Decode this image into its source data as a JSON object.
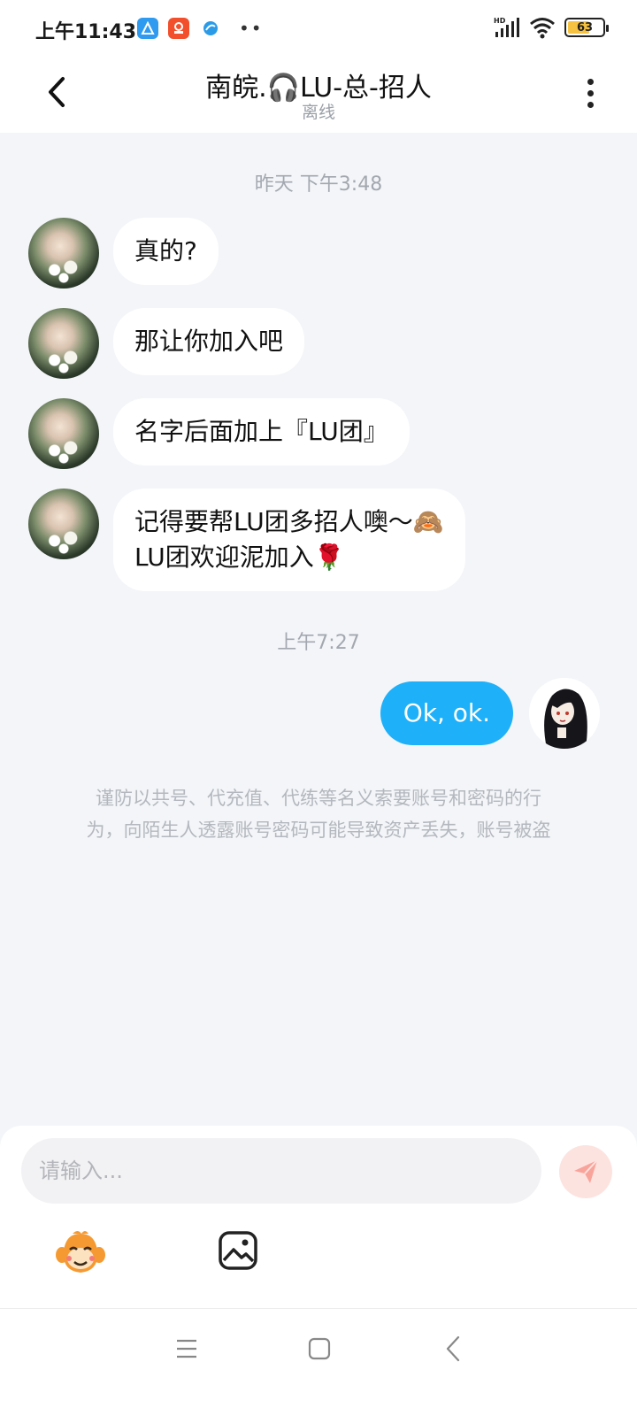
{
  "status_bar": {
    "time": "上午11:43",
    "battery": "63",
    "battery_level": 0.63,
    "icons": [
      "blue-a-app-icon",
      "orange-app-icon",
      "blue-bird-app-icon",
      "more-dots-icon",
      "hd-signal-icon",
      "wifi-icon",
      "battery-icon"
    ]
  },
  "header": {
    "title": "南皖.🎧LU-总-招人",
    "subtitle": "离线"
  },
  "messages": [
    {
      "type": "timestamp",
      "text": "昨天 下午3:48"
    },
    {
      "type": "incoming",
      "text": "真的?"
    },
    {
      "type": "incoming",
      "text": "那让你加入吧"
    },
    {
      "type": "incoming",
      "text": "名字后面加上『LU团』"
    },
    {
      "type": "incoming",
      "lines": [
        "记得要帮LU团多招人噢～🙈",
        "LU团欢迎泥加入🌹"
      ]
    },
    {
      "type": "timestamp",
      "text": "上午7:27"
    },
    {
      "type": "outgoing",
      "text": "Ok, ok."
    }
  ],
  "warning": {
    "lines": [
      "谨防以共号、代充值、代练等名义索要账号和密码的行",
      "为，向陌生人透露账号密码可能导致资产丢失，账号被盗"
    ]
  },
  "input": {
    "placeholder": "请输入..."
  },
  "colors": {
    "accent_blue": "#1eb0f8",
    "send_button_bg": "#fde3e0",
    "send_icon": "#f8a49a",
    "background": "#f3f5f8"
  }
}
